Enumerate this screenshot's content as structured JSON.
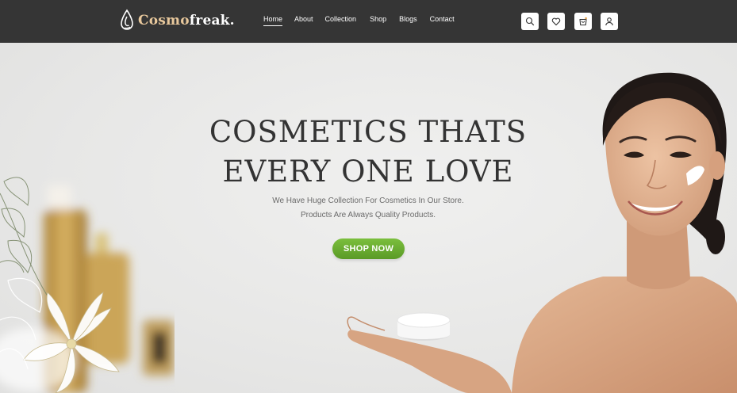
{
  "header": {
    "logo": {
      "accent": "Cosmo",
      "rest": "freak."
    },
    "nav": [
      {
        "label": "Home",
        "active": true
      },
      {
        "label": "About",
        "active": false
      },
      {
        "label": "Collection",
        "active": false
      },
      {
        "label": "Shop",
        "active": false
      },
      {
        "label": "Blogs",
        "active": false
      },
      {
        "label": "Contact",
        "active": false
      }
    ],
    "icons": [
      "search-icon",
      "heart-icon",
      "cart-icon",
      "user-icon"
    ]
  },
  "hero": {
    "title_line1": "COSMETICS THATS",
    "title_line2": "EVERY ONE LOVE",
    "subtitle_line1": "We Have Huge Collection For Cosmetics In Our Store.",
    "subtitle_line2": "Products Are Always Quality Products.",
    "cta": "SHOP NOW"
  },
  "colors": {
    "header_bg": "#353535",
    "logo_accent": "#e8c89c",
    "cta_green": "#6aab30",
    "hero_bg": "#e9e9e8"
  }
}
